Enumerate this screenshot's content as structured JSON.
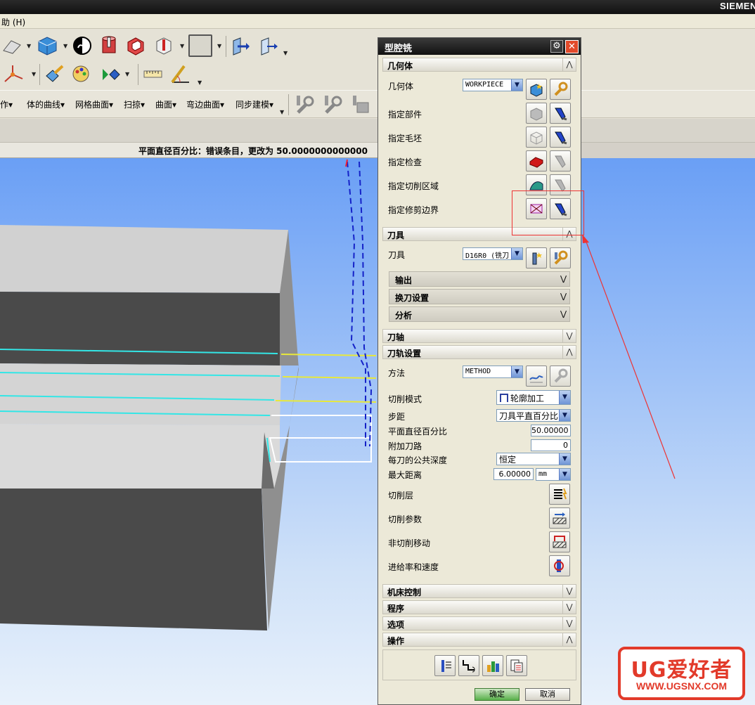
{
  "app": {
    "brand": "SIEMENS"
  },
  "menubar": {
    "help": "助 (H)"
  },
  "toolbar_menus": [
    "作▾",
    "体的曲线▾",
    "网格曲面▾",
    "扫掠▾",
    "曲面▾",
    "弯边曲面▾",
    "同步建模▾"
  ],
  "status": {
    "message": "平面直径百分比：错误条目，更改为 50.0000000000000"
  },
  "dialog": {
    "title": "型腔铣",
    "sections": {
      "geometry": "几何体",
      "tool": "刀具",
      "tool_axis": "刀轴",
      "path_settings": "刀轨设置",
      "machine_control": "机床控制",
      "program": "程序",
      "options": "选项",
      "operations": "操作"
    },
    "geometry": {
      "geometry_label": "几何体",
      "geometry_value": "WORKPIECE",
      "part": "指定部件",
      "blank": "指定毛坯",
      "check": "指定检查",
      "cut_area": "指定切削区域",
      "trim_boundary": "指定修剪边界"
    },
    "tool": {
      "tool_label": "刀具",
      "tool_value": "D16R0 (铣刀",
      "subsections": [
        "输出",
        "换刀设置",
        "分析"
      ]
    },
    "path": {
      "method_label": "方法",
      "method_value": "METHOD",
      "cut_mode_label": "切削模式",
      "cut_mode_value": "轮廓加工",
      "stepover_label": "步距",
      "stepover_value": "刀具平直百分比",
      "flat_pct_label": "平面直径百分比",
      "flat_pct_value": "50.00000",
      "extra_passes_label": "附加刀路",
      "extra_passes_value": "0",
      "depth_label": "每刀的公共深度",
      "depth_value": "恒定",
      "max_dist_label": "最大距离",
      "max_dist_value": "6.00000",
      "max_dist_unit": "mm",
      "cut_levels": "切削层",
      "cut_params": "切削参数",
      "non_cut": "非切削移动",
      "feeds": "进给率和速度"
    },
    "buttons": {
      "ok": "确定",
      "cancel": "取消"
    }
  },
  "watermark": {
    "title": "UG爱好者",
    "url": "WWW.UGSNX.COM"
  },
  "colors": {
    "accent_red": "#e23a2a",
    "sky_top": "#6a9ff5",
    "dialog_bg": "#ece9d8"
  }
}
